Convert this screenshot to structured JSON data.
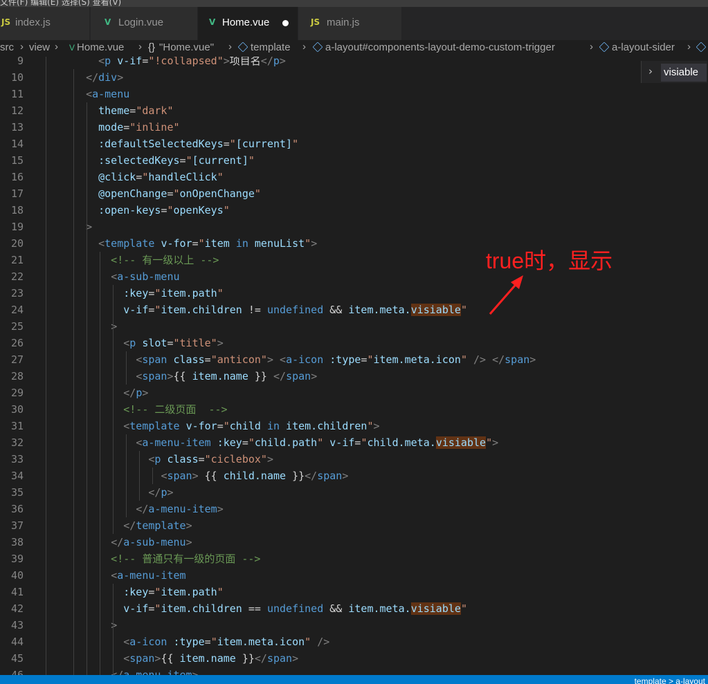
{
  "window": {
    "title_fragment": "文件(F)  编辑(E)  选择(S)  查看(V)"
  },
  "tabs": [
    {
      "label": "index.js",
      "type": "JS"
    },
    {
      "label": "Login.vue",
      "type": "V"
    },
    {
      "label": "Home.vue",
      "type": "V",
      "active": true,
      "modified": true
    },
    {
      "label": "main.js",
      "type": "JS"
    }
  ],
  "breadcrumb": {
    "items": [
      "src",
      "view",
      "Home.vue",
      "\"Home.vue\"",
      "template",
      "a-layout#components-layout-demo-custom-trigger",
      "a-layout-sider"
    ],
    "curly_icon": "{}"
  },
  "suggest": {
    "item": "visiable"
  },
  "annotation": {
    "text": "true时，显示"
  },
  "status": {
    "text": "template > a-layout"
  },
  "colors": {
    "accent": "#007acc",
    "annotation": "#ff2020",
    "highlight": "#613214"
  },
  "code": {
    "lines": [
      {
        "n": "9",
        "indent": 0,
        "tokens": [
          [
            "tag",
            "    <p "
          ],
          [
            "attr",
            "v-if"
          ],
          [
            "text",
            "="
          ],
          [
            "str",
            "\"!collapsed\""
          ],
          [
            "tag",
            ">"
          ],
          [
            "text",
            "项目名"
          ],
          [
            "tag",
            "</p>"
          ]
        ]
      },
      {
        "n": "10",
        "tokens": [
          [
            "tag",
            "  </div>"
          ]
        ]
      },
      {
        "n": "11",
        "tokens": [
          [
            "tag",
            "  <a-menu"
          ]
        ]
      },
      {
        "n": "12",
        "tokens": [
          [
            "attr",
            "    theme"
          ],
          [
            "text",
            "="
          ],
          [
            "str",
            "\"dark\""
          ]
        ]
      },
      {
        "n": "13",
        "tokens": [
          [
            "attr",
            "    mode"
          ],
          [
            "text",
            "="
          ],
          [
            "str",
            "\"inline\""
          ]
        ]
      },
      {
        "n": "14",
        "tokens": [
          [
            "attr",
            "    :defaultSelectedKeys"
          ],
          [
            "text",
            "="
          ],
          [
            "str",
            "\""
          ],
          [
            "attr",
            "[current]"
          ],
          [
            "str",
            "\""
          ]
        ]
      },
      {
        "n": "15",
        "tokens": [
          [
            "attr",
            "    :selectedKeys"
          ],
          [
            "text",
            "="
          ],
          [
            "str",
            "\""
          ],
          [
            "attr",
            "[current]"
          ],
          [
            "str",
            "\""
          ]
        ]
      },
      {
        "n": "16",
        "tokens": [
          [
            "attr",
            "    @click"
          ],
          [
            "text",
            "="
          ],
          [
            "str",
            "\""
          ],
          [
            "attr",
            "handleClick"
          ],
          [
            "str",
            "\""
          ]
        ]
      },
      {
        "n": "17",
        "tokens": [
          [
            "attr",
            "    @openChange"
          ],
          [
            "text",
            "="
          ],
          [
            "str",
            "\""
          ],
          [
            "attr",
            "onOpenChange"
          ],
          [
            "str",
            "\""
          ]
        ]
      },
      {
        "n": "18",
        "tokens": [
          [
            "attr",
            "    :open-keys"
          ],
          [
            "text",
            "="
          ],
          [
            "str",
            "\""
          ],
          [
            "attr",
            "openKeys"
          ],
          [
            "str",
            "\""
          ]
        ]
      },
      {
        "n": "19",
        "tokens": [
          [
            "tag",
            "  >"
          ]
        ]
      },
      {
        "n": "20",
        "tokens": [
          [
            "tag",
            "    <template "
          ],
          [
            "attr",
            "v-for"
          ],
          [
            "text",
            "="
          ],
          [
            "str",
            "\""
          ],
          [
            "attr",
            "item "
          ],
          [
            "kw",
            "in"
          ],
          [
            "attr",
            " menuList"
          ],
          [
            "str",
            "\""
          ],
          [
            "tag",
            ">"
          ]
        ]
      },
      {
        "n": "21",
        "tokens": [
          [
            "comment",
            "      <!-- 有一级以上 -->"
          ]
        ]
      },
      {
        "n": "22",
        "tokens": [
          [
            "tag",
            "      <a-sub-menu"
          ]
        ]
      },
      {
        "n": "23",
        "tokens": [
          [
            "attr",
            "        :key"
          ],
          [
            "text",
            "="
          ],
          [
            "str",
            "\""
          ],
          [
            "attr",
            "item.path"
          ],
          [
            "str",
            "\""
          ]
        ]
      },
      {
        "n": "24",
        "tokens": [
          [
            "attr",
            "        v-if"
          ],
          [
            "text",
            "="
          ],
          [
            "str",
            "\""
          ],
          [
            "attr",
            "item.children "
          ],
          [
            "text",
            "!= "
          ],
          [
            "kw",
            "undefined"
          ],
          [
            "text",
            " && "
          ],
          [
            "attr",
            "item.meta."
          ],
          [
            "hl",
            "visiable"
          ],
          [
            "str",
            "\""
          ]
        ]
      },
      {
        "n": "25",
        "tokens": [
          [
            "tag",
            "      >"
          ]
        ]
      },
      {
        "n": "26",
        "tokens": [
          [
            "tag",
            "        <p "
          ],
          [
            "attr",
            "slot"
          ],
          [
            "text",
            "="
          ],
          [
            "str",
            "\"title\""
          ],
          [
            "tag",
            ">"
          ]
        ]
      },
      {
        "n": "27",
        "tokens": [
          [
            "tag",
            "          <span "
          ],
          [
            "attr",
            "class"
          ],
          [
            "text",
            "="
          ],
          [
            "str",
            "\"anticon\""
          ],
          [
            "tag",
            ">"
          ],
          [
            "text",
            " "
          ],
          [
            "tag",
            "<a-icon "
          ],
          [
            "attr",
            ":type"
          ],
          [
            "text",
            "="
          ],
          [
            "str",
            "\""
          ],
          [
            "attr",
            "item.meta.icon"
          ],
          [
            "str",
            "\""
          ],
          [
            "tag",
            " />"
          ],
          [
            "text",
            " "
          ],
          [
            "tag",
            "</span>"
          ]
        ]
      },
      {
        "n": "28",
        "tokens": [
          [
            "tag",
            "          <span>"
          ],
          [
            "text",
            "{{ "
          ],
          [
            "attr",
            "item.name"
          ],
          [
            "text",
            " }} "
          ],
          [
            "tag",
            "</span>"
          ]
        ]
      },
      {
        "n": "29",
        "tokens": [
          [
            "tag",
            "        </p>"
          ]
        ]
      },
      {
        "n": "30",
        "tokens": [
          [
            "comment",
            "        <!-- 二级页面  -->"
          ]
        ]
      },
      {
        "n": "31",
        "tokens": [
          [
            "tag",
            "        <template "
          ],
          [
            "attr",
            "v-for"
          ],
          [
            "text",
            "="
          ],
          [
            "str",
            "\""
          ],
          [
            "attr",
            "child "
          ],
          [
            "kw",
            "in"
          ],
          [
            "attr",
            " item.children"
          ],
          [
            "str",
            "\""
          ],
          [
            "tag",
            ">"
          ]
        ]
      },
      {
        "n": "32",
        "tokens": [
          [
            "tag",
            "          <a-menu-item "
          ],
          [
            "attr",
            ":key"
          ],
          [
            "text",
            "="
          ],
          [
            "str",
            "\""
          ],
          [
            "attr",
            "child.path"
          ],
          [
            "str",
            "\""
          ],
          [
            "text",
            " "
          ],
          [
            "attr",
            "v-if"
          ],
          [
            "text",
            "="
          ],
          [
            "str",
            "\""
          ],
          [
            "attr",
            "child.meta."
          ],
          [
            "hl",
            "visiable"
          ],
          [
            "str",
            "\""
          ],
          [
            "tag",
            ">"
          ]
        ]
      },
      {
        "n": "33",
        "tokens": [
          [
            "tag",
            "            <p "
          ],
          [
            "attr",
            "class"
          ],
          [
            "text",
            "="
          ],
          [
            "str",
            "\"ciclebox\""
          ],
          [
            "tag",
            ">"
          ]
        ]
      },
      {
        "n": "34",
        "tokens": [
          [
            "tag",
            "              <span>"
          ],
          [
            "text",
            " {{ "
          ],
          [
            "attr",
            "child.name"
          ],
          [
            "text",
            " }}"
          ],
          [
            "tag",
            "</span>"
          ]
        ]
      },
      {
        "n": "35",
        "tokens": [
          [
            "tag",
            "            </p>"
          ]
        ]
      },
      {
        "n": "36",
        "tokens": [
          [
            "tag",
            "          </a-menu-item>"
          ]
        ]
      },
      {
        "n": "37",
        "tokens": [
          [
            "tag",
            "        </template>"
          ]
        ]
      },
      {
        "n": "38",
        "tokens": [
          [
            "tag",
            "      </a-sub-menu>"
          ]
        ]
      },
      {
        "n": "39",
        "tokens": [
          [
            "comment",
            "      <!-- 普通只有一级的页面 -->"
          ]
        ]
      },
      {
        "n": "40",
        "tokens": [
          [
            "tag",
            "      <a-menu-item"
          ]
        ]
      },
      {
        "n": "41",
        "tokens": [
          [
            "attr",
            "        :key"
          ],
          [
            "text",
            "="
          ],
          [
            "str",
            "\""
          ],
          [
            "attr",
            "item.path"
          ],
          [
            "str",
            "\""
          ]
        ]
      },
      {
        "n": "42",
        "tokens": [
          [
            "attr",
            "        v-if"
          ],
          [
            "text",
            "="
          ],
          [
            "str",
            "\""
          ],
          [
            "attr",
            "item.children "
          ],
          [
            "text",
            "== "
          ],
          [
            "kw",
            "undefined"
          ],
          [
            "text",
            " && "
          ],
          [
            "attr",
            "item.meta."
          ],
          [
            "hl",
            "visiable"
          ],
          [
            "str",
            "\""
          ]
        ]
      },
      {
        "n": "43",
        "tokens": [
          [
            "tag",
            "      >"
          ]
        ]
      },
      {
        "n": "44",
        "tokens": [
          [
            "tag",
            "        <a-icon "
          ],
          [
            "attr",
            ":type"
          ],
          [
            "text",
            "="
          ],
          [
            "str",
            "\""
          ],
          [
            "attr",
            "item.meta.icon"
          ],
          [
            "str",
            "\""
          ],
          [
            "tag",
            " />"
          ]
        ]
      },
      {
        "n": "45",
        "tokens": [
          [
            "tag",
            "        <span>"
          ],
          [
            "text",
            "{{ "
          ],
          [
            "attr",
            "item.name"
          ],
          [
            "text",
            " }}"
          ],
          [
            "tag",
            "</span>"
          ]
        ]
      },
      {
        "n": "46",
        "tokens": [
          [
            "tag",
            "      </a-menu-item>"
          ]
        ]
      }
    ]
  }
}
